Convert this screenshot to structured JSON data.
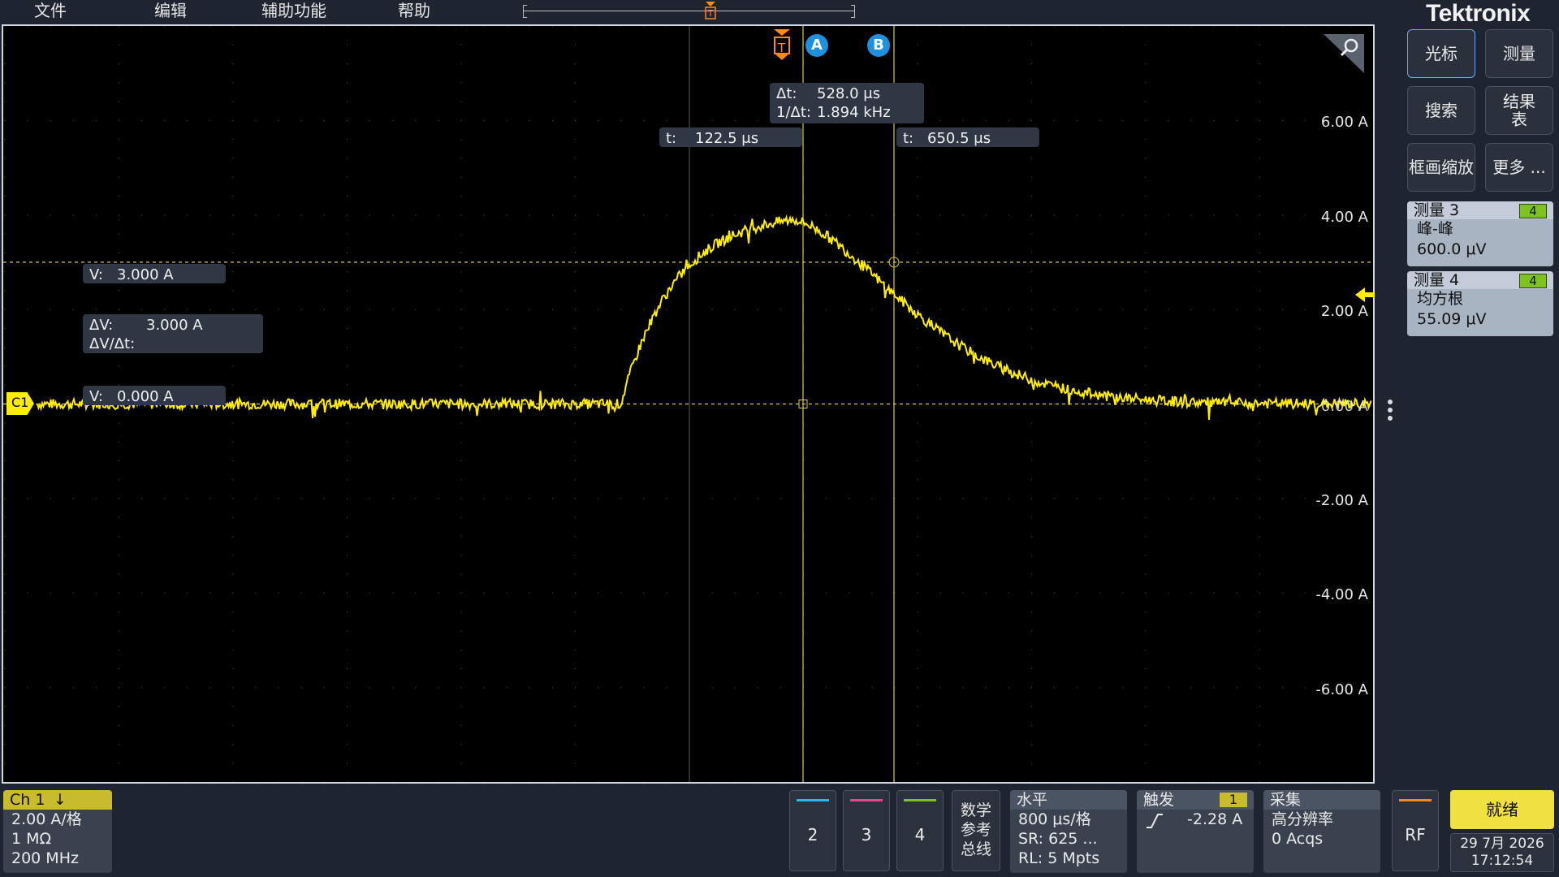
{
  "menu": [
    "文件",
    "编辑",
    "辅助功能",
    "帮助"
  ],
  "brand": "Tektronix",
  "cursor_readouts": {
    "delta_t_label": "Δt:",
    "delta_t": "528.0 μs",
    "inv_delta_t_label": "1/Δt:",
    "inv_delta_t": "1.894 kHz",
    "t_a_label": "t:",
    "t_a": "122.5 μs",
    "t_b_label": "t:",
    "t_b": "650.5 μs",
    "v_b_label": "V:",
    "v_b": "3.000 A",
    "delta_v_label": "ΔV:",
    "delta_v": "3.000 A",
    "dv_dt_label": "ΔV/Δt:",
    "v_a_label": "V:",
    "v_a": "0.000 A"
  },
  "cursor_markers": {
    "trigger": "T",
    "a": "A",
    "b": "B"
  },
  "channel_marker": "C1",
  "y_axis_labels": [
    "6.00 A",
    "4.00 A",
    "2.00 A",
    "0.00 A",
    "-2.00 A",
    "-4.00 A",
    "-6.00 A"
  ],
  "right_panel": {
    "buttons": [
      "光标",
      "测量",
      "搜索",
      "结果表",
      "框画缩放",
      "更多 ..."
    ],
    "measurements": [
      {
        "title": "测量 3",
        "badge": "4",
        "type": "峰-峰",
        "value": "600.0 μV"
      },
      {
        "title": "测量 4",
        "badge": "4",
        "type": "均方根",
        "value": "55.09 μV"
      }
    ]
  },
  "ch1": {
    "title": "Ch 1",
    "scale": "2.00 A/格",
    "impedance": "1 MΩ",
    "bandwidth": "200 MHz"
  },
  "channel_buttons": [
    {
      "label": "2",
      "color": "#29b6e8"
    },
    {
      "label": "3",
      "color": "#e8458b"
    },
    {
      "label": "4",
      "color": "#7ec220"
    }
  ],
  "math_ref_bus": [
    "数学",
    "参考",
    "总线"
  ],
  "horizontal": {
    "title": "水平",
    "scale": "800 μs/格",
    "sample_rate": "SR: 625 ...",
    "record_length": "RL: 5 Mpts"
  },
  "trigger": {
    "title": "触发",
    "badge": "1",
    "level": "-2.28 A"
  },
  "acquisition": {
    "title": "采集",
    "mode": "高分辨率",
    "count": "0 Acqs"
  },
  "rf": "RF",
  "status": {
    "state": "就绪",
    "date": "29 7月 2026",
    "time": "17:12:54"
  },
  "colors": {
    "trace": "#ffee00",
    "cursor": "#d8c850",
    "accent_trigger": "#ff8a1a",
    "cursor_badge": "#1e90e0"
  },
  "waveform": {
    "x_unit": "div",
    "y_unit": "A",
    "baseline_a": 0.0,
    "rise_start_div": 5.4,
    "peak_div": 6.9,
    "peak_a": 3.9,
    "end_div": 13.7
  }
}
